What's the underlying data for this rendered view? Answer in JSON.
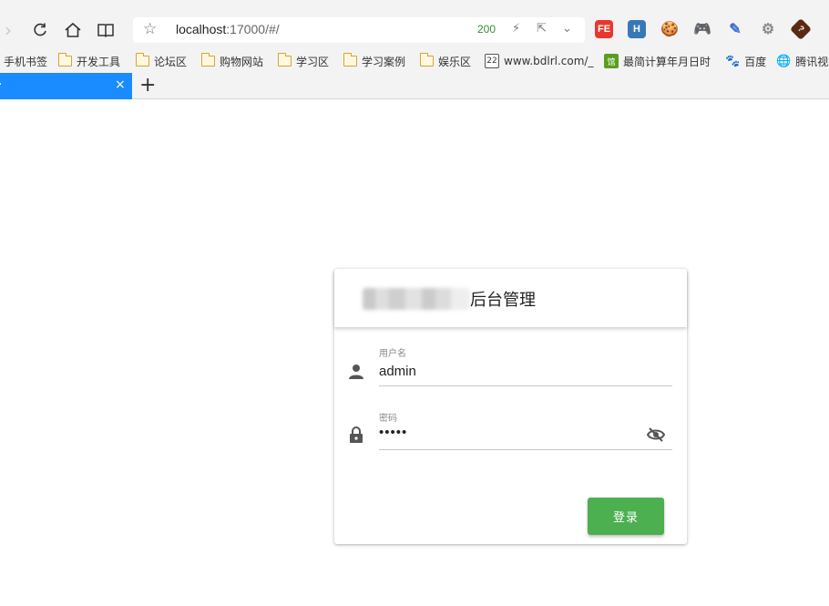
{
  "browser": {
    "url_host": "localhost",
    "url_rest": ":17000/#/",
    "status_code": "200",
    "extensions": [
      {
        "name": "fe-helper-icon",
        "text": "FE",
        "color": "#e8382d"
      },
      {
        "name": "h-extension-icon",
        "text": "H",
        "color": "#3778b8"
      },
      {
        "name": "cookie-icon",
        "text": "",
        "color": "#d79b3b"
      },
      {
        "name": "gamepad-icon",
        "text": "",
        "color": "#f26a1b"
      },
      {
        "name": "color-picker-icon",
        "text": "",
        "color": "#3b6fd1"
      },
      {
        "name": "settings-gear-icon",
        "text": "",
        "color": "#8c8c8c"
      },
      {
        "name": "help-diamond-icon",
        "text": "?",
        "color": "#5a2b12"
      }
    ]
  },
  "bookmarks": [
    {
      "label": "手机书签",
      "type": "text"
    },
    {
      "label": "开发工具",
      "type": "folder"
    },
    {
      "label": "论坛区",
      "type": "folder"
    },
    {
      "label": "购物网站",
      "type": "folder"
    },
    {
      "label": "学习区",
      "type": "folder"
    },
    {
      "label": "学习案例",
      "type": "folder"
    },
    {
      "label": "娱乐区",
      "type": "folder"
    },
    {
      "label": "www.bdlrl.com/_",
      "type": "site",
      "badge": "22"
    },
    {
      "label": "最简计算年月日时",
      "type": "site",
      "badge": "馆"
    },
    {
      "label": "百度",
      "type": "site",
      "badge": ""
    },
    {
      "label": "腾讯视",
      "type": "site",
      "badge": ""
    }
  ],
  "tabs": {
    "active_close": "×",
    "new_tab": "+"
  },
  "login": {
    "title": "后台管理",
    "username_label": "用户名",
    "username_value": "admin",
    "password_label": "密码",
    "password_value": "•••••",
    "submit_label": "登录",
    "button_color": "#4caf50"
  }
}
